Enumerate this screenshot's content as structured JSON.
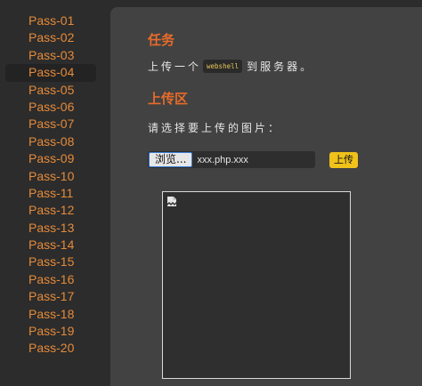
{
  "sidebar": {
    "items": [
      {
        "label": "Pass-01",
        "active": false
      },
      {
        "label": "Pass-02",
        "active": false
      },
      {
        "label": "Pass-03",
        "active": false
      },
      {
        "label": "Pass-04",
        "active": true
      },
      {
        "label": "Pass-05",
        "active": false
      },
      {
        "label": "Pass-06",
        "active": false
      },
      {
        "label": "Pass-07",
        "active": false
      },
      {
        "label": "Pass-08",
        "active": false
      },
      {
        "label": "Pass-09",
        "active": false
      },
      {
        "label": "Pass-10",
        "active": false
      },
      {
        "label": "Pass-11",
        "active": false
      },
      {
        "label": "Pass-12",
        "active": false
      },
      {
        "label": "Pass-13",
        "active": false
      },
      {
        "label": "Pass-14",
        "active": false
      },
      {
        "label": "Pass-15",
        "active": false
      },
      {
        "label": "Pass-16",
        "active": false
      },
      {
        "label": "Pass-17",
        "active": false
      },
      {
        "label": "Pass-18",
        "active": false
      },
      {
        "label": "Pass-19",
        "active": false
      },
      {
        "label": "Pass-20",
        "active": false
      }
    ]
  },
  "task": {
    "title": "任务",
    "desc_before": "上传一个",
    "code": "webshell",
    "desc_after": "到服务器。"
  },
  "upload": {
    "title": "上传区",
    "prompt": "请选择要上传的图片：",
    "browse_label": "浏览...",
    "file_name": "xxx.php.xxx",
    "submit_label": "上传"
  },
  "preview": {
    "icon": "broken-image-icon"
  },
  "colors": {
    "accent_orange": "#e86b2a",
    "link_orange": "#e58a3a",
    "button_yellow": "#f0c21a",
    "panel_bg": "#424242",
    "sidebar_bg": "#2c2c2c"
  }
}
